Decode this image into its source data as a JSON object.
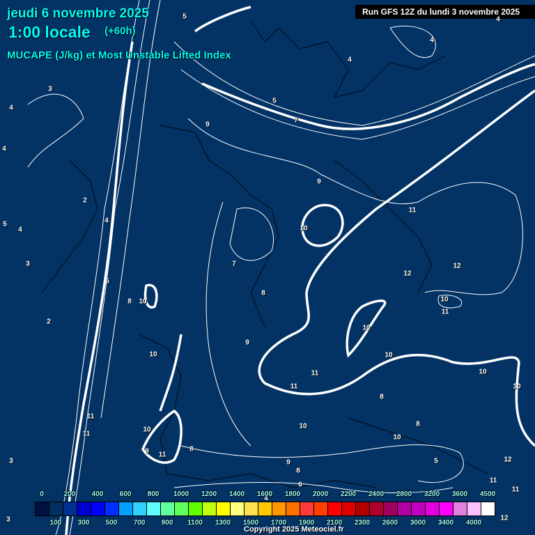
{
  "header": {
    "date": "jeudi 6 novembre 2025",
    "time": "1:00 locale",
    "lead": "(+60h)",
    "parameter": "MUCAPE (J/kg) et Most Unstable Lifted Index",
    "run": "Run GFS 12Z du lundi 3 novembre 2025"
  },
  "contour_labels": [
    "5",
    "3",
    "4",
    "4",
    "2",
    "4",
    "5",
    "4",
    "3",
    "6",
    "8",
    "10",
    "2",
    "10",
    "11",
    "11",
    "10",
    "9",
    "11",
    "8",
    "3",
    "3",
    "9",
    "5",
    "7",
    "4",
    "4",
    "4",
    "9",
    "10",
    "7",
    "8",
    "9",
    "11",
    "12",
    "12",
    "10",
    "11",
    "10",
    "10",
    "11",
    "11",
    "10",
    "10",
    "8",
    "8",
    "10",
    "10",
    "5",
    "9",
    "8",
    "6",
    "12",
    "11",
    "11",
    "12",
    "4"
  ],
  "legend": {
    "unit": "J/kg",
    "levels": [
      "0",
      "100",
      "200",
      "300",
      "400",
      "500",
      "600",
      "700",
      "800",
      "900",
      "1000",
      "1100",
      "1200",
      "1300",
      "1400",
      "1500",
      "1600",
      "1700",
      "1800",
      "1900",
      "2000",
      "2100",
      "2200",
      "2300",
      "2400",
      "2600",
      "2800",
      "3000",
      "3200",
      "3400",
      "3600",
      "4000",
      "4500"
    ],
    "colors": [
      "#001040",
      "#00305f",
      "#003090",
      "#0000d0",
      "#0000ff",
      "#0030ff",
      "#00a0ff",
      "#30d0ff",
      "#60ffff",
      "#60ffa0",
      "#60ff60",
      "#60ff00",
      "#c0ff10",
      "#ffff00",
      "#ffff80",
      "#ffe050",
      "#ffc800",
      "#ff9800",
      "#ff7000",
      "#ff3838",
      "#ff4000",
      "#ff0000",
      "#e00000",
      "#b00000",
      "#b00030",
      "#a00060",
      "#b000a0",
      "#c000c0",
      "#e000e0",
      "#ff00ff",
      "#e080e0",
      "#ffc0ff",
      "#ffffff"
    ]
  },
  "copyright": "Copyright 2025 Meteociel.fr"
}
